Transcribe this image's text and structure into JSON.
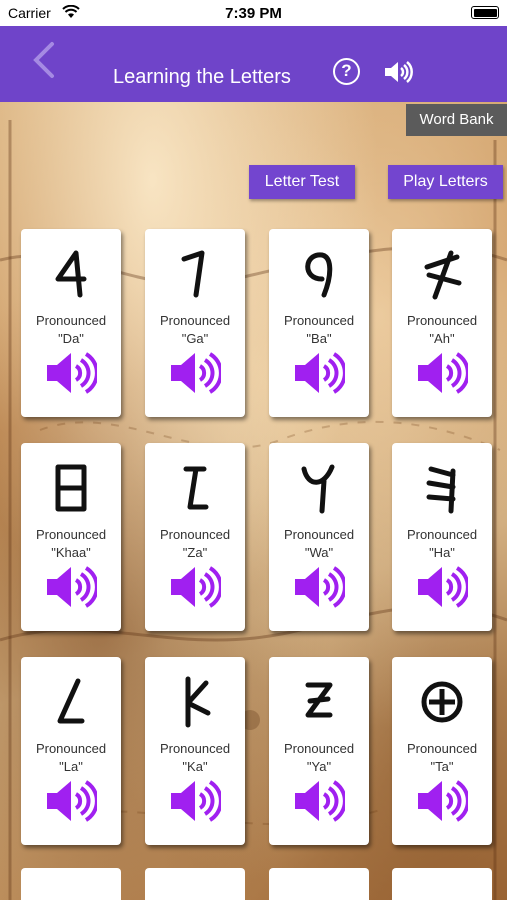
{
  "status_bar": {
    "carrier": "Carrier",
    "time": "7:39 PM"
  },
  "nav": {
    "title": "Learning the Letters",
    "help_label": "?"
  },
  "buttons": {
    "word_bank": "Word Bank",
    "letter_test": "Letter Test",
    "play_letters": "Play Letters"
  },
  "colors": {
    "nav_purple": "#6f44c9",
    "speaker_purple": "#a020f0",
    "button_purple": "#7345cf"
  },
  "cards": [
    {
      "glyph": "da-letter-glyph",
      "label": "Pronounced",
      "sound": "\"Da\""
    },
    {
      "glyph": "ga-letter-glyph",
      "label": "Pronounced",
      "sound": "\"Ga\""
    },
    {
      "glyph": "ba-letter-glyph",
      "label": "Pronounced",
      "sound": "\"Ba\""
    },
    {
      "glyph": "ah-letter-glyph",
      "label": "Pronounced",
      "sound": "\"Ah\""
    },
    {
      "glyph": "khaa-letter-glyph",
      "label": "Pronounced",
      "sound": "\"Khaa\""
    },
    {
      "glyph": "za-letter-glyph",
      "label": "Pronounced",
      "sound": "\"Za\""
    },
    {
      "glyph": "wa-letter-glyph",
      "label": "Pronounced",
      "sound": "\"Wa\""
    },
    {
      "glyph": "ha-letter-glyph",
      "label": "Pronounced",
      "sound": "\"Ha\""
    },
    {
      "glyph": "la-letter-glyph",
      "label": "Pronounced",
      "sound": "\"La\""
    },
    {
      "glyph": "ka-letter-glyph",
      "label": "Pronounced",
      "sound": "\"Ka\""
    },
    {
      "glyph": "ya-letter-glyph",
      "label": "Pronounced",
      "sound": "\"Ya\""
    },
    {
      "glyph": "ta-letter-glyph",
      "label": "Pronounced",
      "sound": "\"Ta\""
    }
  ]
}
